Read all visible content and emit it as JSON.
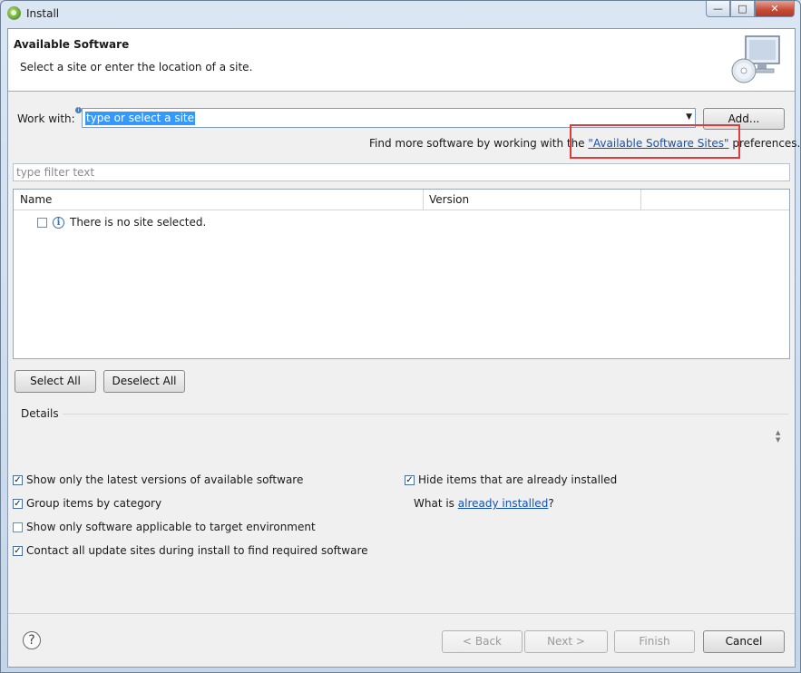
{
  "window": {
    "title": "Install"
  },
  "header": {
    "title": "Available Software",
    "description": "Select a site or enter the location of a site."
  },
  "work_with": {
    "label": "Work with:",
    "value": "type or select a site",
    "add_label": "Add..."
  },
  "hint": {
    "prefix": "Find more software by working with the ",
    "link": "\"Available Software Sites\"",
    "suffix": " preferences."
  },
  "filter": {
    "placeholder": "type filter text"
  },
  "table": {
    "columns": [
      "Name",
      "Version"
    ],
    "rows": [
      {
        "text": "There is no site selected.",
        "checked": false
      }
    ]
  },
  "buttons": {
    "select_all": "Select All",
    "deselect_all": "Deselect All"
  },
  "details": {
    "label": "Details"
  },
  "options": {
    "latest_only": {
      "label": "Show only the latest versions of available software",
      "checked": true
    },
    "group_by_category": {
      "label": "Group items by category",
      "checked": true
    },
    "target_env": {
      "label": "Show only software applicable to target environment",
      "checked": false
    },
    "contact_sites": {
      "label": "Contact all update sites during install to find required software",
      "checked": true
    },
    "hide_installed": {
      "label": "Hide items that are already installed",
      "checked": true
    },
    "what_is_prefix": "What is ",
    "what_is_link": "already installed",
    "what_is_suffix": "?"
  },
  "footer": {
    "back": "< Back",
    "next": "Next >",
    "finish": "Finish",
    "cancel": "Cancel",
    "help_glyph": "?"
  }
}
